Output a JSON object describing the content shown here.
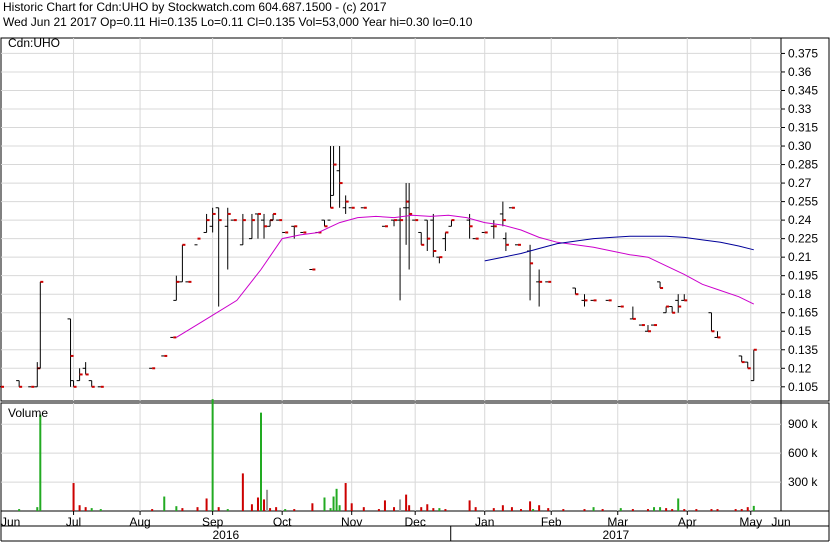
{
  "header": {
    "line1": "Historic Chart for Cdn:UHO by Stockwatch.com 604.687.1500 - (c) 2017",
    "line2": "Wed Jun 21 2017   Op=0.11   Hi=0.135   Lo=0.11   Cl=0.135   Vol=53,000   Year hi=0.30   lo=0.10"
  },
  "chart_data": {
    "type": "ohlc",
    "title": "Historic Chart for Cdn:UHO by Stockwatch.com 604.687.1500 - (c) 2017",
    "symbol_label": "Cdn:UHO",
    "summary": {
      "date": "Wed Jun 21 2017",
      "open": 0.11,
      "high": 0.135,
      "low": 0.11,
      "close": 0.135,
      "volume": 53000,
      "year_high": 0.3,
      "year_low": 0.1
    },
    "colors": {
      "ma_short": "#cc00cc",
      "ma_long": "#000099",
      "vol_up": "#22aa22",
      "vol_down": "#cc0000",
      "vol_flat": "#999999",
      "close_tick": "#cc0000",
      "grid": "#d8d8d8"
    },
    "price_axis": {
      "ylim": [
        0.0935,
        0.3875
      ],
      "ticks": [
        "0.375",
        "0.36",
        "0.345",
        "0.33",
        "0.315",
        "0.30",
        "0.285",
        "0.27",
        "0.255",
        "0.24",
        "0.225",
        "0.21",
        "0.195",
        "0.18",
        "0.165",
        "0.15",
        "0.135",
        "0.12",
        "0.105"
      ]
    },
    "volume_axis": {
      "label": "Volume",
      "ylim": [
        0,
        1120000
      ],
      "ticks": [
        "900 k",
        "600 k",
        "300 k"
      ]
    },
    "x_axis": {
      "months": [
        "Jun",
        "Jul",
        "Aug",
        "Sep",
        "Oct",
        "Nov",
        "Dec",
        "Jan",
        "Feb",
        "Mar",
        "Apr",
        "May",
        "Jun"
      ],
      "years": [
        "2016",
        "2017"
      ]
    },
    "x_range": [
      0,
      258
    ],
    "month_positions": [
      0,
      24,
      46,
      70,
      93,
      116,
      137,
      160,
      182,
      204,
      227,
      248,
      258
    ],
    "ohlc": [
      [
        0,
        0.105,
        0.105,
        0.105,
        0.105
      ],
      [
        6,
        0.11,
        0.11,
        0.105,
        0.105
      ],
      [
        10,
        0.105,
        0.105,
        0.105,
        0.105
      ],
      [
        12,
        0.105,
        0.125,
        0.105,
        0.12
      ],
      [
        13,
        0.12,
        0.19,
        0.12,
        0.19
      ],
      [
        23,
        0.16,
        0.16,
        0.105,
        0.13
      ],
      [
        24,
        0.11,
        0.11,
        0.105,
        0.105
      ],
      [
        26,
        0.11,
        0.12,
        0.11,
        0.115
      ],
      [
        28,
        0.12,
        0.125,
        0.115,
        0.115
      ],
      [
        30,
        0.11,
        0.11,
        0.105,
        0.105
      ],
      [
        33,
        0.105,
        0.105,
        0.105,
        0.105
      ],
      [
        50,
        0.12,
        0.12,
        0.12,
        0.12
      ],
      [
        54,
        0.13,
        0.13,
        0.13,
        0.13
      ],
      [
        57,
        0.145,
        0.145,
        0.145,
        0.145
      ],
      [
        58,
        0.175,
        0.195,
        0.175,
        0.19
      ],
      [
        60,
        0.19,
        0.22,
        0.19,
        0.22
      ],
      [
        62,
        0.19,
        0.19,
        0.19,
        0.19
      ],
      [
        65,
        0.22,
        0.22,
        0.22,
        0.225
      ],
      [
        68,
        0.23,
        0.245,
        0.23,
        0.24
      ],
      [
        70,
        0.235,
        0.25,
        0.23,
        0.245
      ],
      [
        72,
        0.25,
        0.25,
        0.17,
        0.24
      ],
      [
        75,
        0.235,
        0.25,
        0.2,
        0.245
      ],
      [
        77,
        0.24,
        0.24,
        0.24,
        0.24
      ],
      [
        80,
        0.22,
        0.245,
        0.22,
        0.24
      ],
      [
        83,
        0.225,
        0.245,
        0.225,
        0.24
      ],
      [
        85,
        0.245,
        0.245,
        0.225,
        0.245
      ],
      [
        87,
        0.24,
        0.245,
        0.225,
        0.235
      ],
      [
        89,
        0.235,
        0.24,
        0.235,
        0.24
      ],
      [
        90,
        0.24,
        0.245,
        0.24,
        0.245
      ],
      [
        92,
        0.24,
        0.24,
        0.24,
        0.24
      ],
      [
        94,
        0.23,
        0.23,
        0.23,
        0.23
      ],
      [
        97,
        0.235,
        0.235,
        0.225,
        0.235
      ],
      [
        100,
        0.23,
        0.23,
        0.23,
        0.23
      ],
      [
        103,
        0.2,
        0.2,
        0.2,
        0.2
      ],
      [
        105,
        0.23,
        0.23,
        0.23,
        0.23
      ],
      [
        107,
        0.24,
        0.24,
        0.235,
        0.235
      ],
      [
        109,
        0.24,
        0.3,
        0.25,
        0.25
      ],
      [
        110,
        0.26,
        0.3,
        0.26,
        0.285
      ],
      [
        112,
        0.28,
        0.3,
        0.25,
        0.27
      ],
      [
        114,
        0.25,
        0.26,
        0.245,
        0.255
      ],
      [
        116,
        0.25,
        0.25,
        0.25,
        0.25
      ],
      [
        120,
        0.25,
        0.25,
        0.25,
        0.25
      ],
      [
        127,
        0.235,
        0.235,
        0.235,
        0.235
      ],
      [
        130,
        0.24,
        0.24,
        0.235,
        0.24
      ],
      [
        132,
        0.24,
        0.25,
        0.175,
        0.24
      ],
      [
        134,
        0.25,
        0.27,
        0.22,
        0.255
      ],
      [
        135,
        0.25,
        0.27,
        0.2,
        0.245
      ],
      [
        137,
        0.24,
        0.24,
        0.24,
        0.24
      ],
      [
        139,
        0.23,
        0.23,
        0.22,
        0.22
      ],
      [
        141,
        0.24,
        0.24,
        0.215,
        0.225
      ],
      [
        143,
        0.24,
        0.245,
        0.21,
        0.215
      ],
      [
        145,
        0.21,
        0.21,
        0.205,
        0.21
      ],
      [
        147,
        0.225,
        0.23,
        0.215,
        0.23
      ],
      [
        149,
        0.235,
        0.24,
        0.235,
        0.24
      ],
      [
        155,
        0.24,
        0.245,
        0.225,
        0.235
      ],
      [
        157,
        0.225,
        0.225,
        0.225,
        0.225
      ],
      [
        160,
        0.23,
        0.23,
        0.23,
        0.23
      ],
      [
        163,
        0.235,
        0.24,
        0.225,
        0.235
      ],
      [
        166,
        0.245,
        0.255,
        0.235,
        0.24
      ],
      [
        167,
        0.225,
        0.23,
        0.215,
        0.22
      ],
      [
        169,
        0.25,
        0.25,
        0.25,
        0.25
      ],
      [
        171,
        0.22,
        0.22,
        0.22,
        0.22
      ],
      [
        175,
        0.215,
        0.22,
        0.175,
        0.205
      ],
      [
        178,
        0.19,
        0.2,
        0.17,
        0.19
      ],
      [
        181,
        0.19,
        0.19,
        0.19,
        0.19
      ],
      [
        190,
        0.185,
        0.185,
        0.18,
        0.18
      ],
      [
        193,
        0.175,
        0.18,
        0.17,
        0.175
      ],
      [
        196,
        0.175,
        0.175,
        0.175,
        0.175
      ],
      [
        201,
        0.175,
        0.175,
        0.175,
        0.175
      ],
      [
        205,
        0.17,
        0.17,
        0.17,
        0.17
      ],
      [
        209,
        0.16,
        0.17,
        0.16,
        0.16
      ],
      [
        212,
        0.155,
        0.155,
        0.155,
        0.155
      ],
      [
        214,
        0.15,
        0.155,
        0.15,
        0.15
      ],
      [
        216,
        0.155,
        0.155,
        0.155,
        0.155
      ],
      [
        218,
        0.19,
        0.19,
        0.185,
        0.185
      ],
      [
        220,
        0.165,
        0.17,
        0.165,
        0.17
      ],
      [
        222,
        0.17,
        0.17,
        0.165,
        0.165
      ],
      [
        224,
        0.175,
        0.18,
        0.165,
        0.17
      ],
      [
        226,
        0.175,
        0.18,
        0.175,
        0.175
      ],
      [
        235,
        0.165,
        0.165,
        0.15,
        0.15
      ],
      [
        237,
        0.145,
        0.15,
        0.145,
        0.145
      ],
      [
        245,
        0.13,
        0.13,
        0.125,
        0.125
      ],
      [
        247,
        0.125,
        0.125,
        0.12,
        0.12
      ],
      [
        249,
        0.11,
        0.135,
        0.11,
        0.135
      ]
    ],
    "ma_short": [
      [
        58,
        0.145
      ],
      [
        68,
        0.16
      ],
      [
        78,
        0.175
      ],
      [
        86,
        0.2
      ],
      [
        93,
        0.225
      ],
      [
        99,
        0.228
      ],
      [
        105,
        0.23
      ],
      [
        112,
        0.238
      ],
      [
        118,
        0.242
      ],
      [
        124,
        0.243
      ],
      [
        130,
        0.242
      ],
      [
        136,
        0.244
      ],
      [
        142,
        0.243
      ],
      [
        148,
        0.244
      ],
      [
        154,
        0.242
      ],
      [
        160,
        0.238
      ],
      [
        166,
        0.236
      ],
      [
        172,
        0.232
      ],
      [
        178,
        0.226
      ],
      [
        184,
        0.222
      ],
      [
        190,
        0.22
      ],
      [
        196,
        0.218
      ],
      [
        202,
        0.215
      ],
      [
        208,
        0.212
      ],
      [
        214,
        0.21
      ],
      [
        220,
        0.203
      ],
      [
        226,
        0.196
      ],
      [
        232,
        0.188
      ],
      [
        238,
        0.183
      ],
      [
        244,
        0.178
      ],
      [
        249,
        0.172
      ]
    ],
    "ma_long": [
      [
        160,
        0.207
      ],
      [
        166,
        0.21
      ],
      [
        172,
        0.213
      ],
      [
        178,
        0.217
      ],
      [
        184,
        0.221
      ],
      [
        190,
        0.223
      ],
      [
        196,
        0.225
      ],
      [
        202,
        0.226
      ],
      [
        208,
        0.227
      ],
      [
        214,
        0.227
      ],
      [
        220,
        0.227
      ],
      [
        226,
        0.226
      ],
      [
        232,
        0.224
      ],
      [
        238,
        0.222
      ],
      [
        244,
        0.219
      ],
      [
        249,
        0.216
      ]
    ],
    "volume": [
      [
        6,
        20000,
        "g"
      ],
      [
        12,
        40000,
        "g"
      ],
      [
        13,
        1000000,
        "g"
      ],
      [
        24,
        290000,
        "r"
      ],
      [
        26,
        60000,
        "r"
      ],
      [
        28,
        40000,
        "r"
      ],
      [
        30,
        30000,
        "g"
      ],
      [
        33,
        20000,
        "g"
      ],
      [
        50,
        20000,
        "r"
      ],
      [
        54,
        150000,
        "g"
      ],
      [
        58,
        50000,
        "g"
      ],
      [
        60,
        30000,
        "r"
      ],
      [
        65,
        40000,
        "r"
      ],
      [
        68,
        130000,
        "r"
      ],
      [
        70,
        1160000,
        "g"
      ],
      [
        72,
        40000,
        "r"
      ],
      [
        75,
        20000,
        "g"
      ],
      [
        80,
        390000,
        "r"
      ],
      [
        83,
        70000,
        "r"
      ],
      [
        85,
        140000,
        "r"
      ],
      [
        86,
        1020000,
        "g"
      ],
      [
        87,
        120000,
        "r"
      ],
      [
        88,
        220000,
        "f"
      ],
      [
        89,
        30000,
        "r"
      ],
      [
        91,
        40000,
        "r"
      ],
      [
        94,
        20000,
        "g"
      ],
      [
        97,
        20000,
        "r"
      ],
      [
        103,
        80000,
        "r"
      ],
      [
        107,
        140000,
        "g"
      ],
      [
        109,
        30000,
        "g"
      ],
      [
        110,
        150000,
        "g"
      ],
      [
        111,
        230000,
        "g"
      ],
      [
        112,
        60000,
        "g"
      ],
      [
        114,
        290000,
        "r"
      ],
      [
        116,
        80000,
        "r"
      ],
      [
        120,
        40000,
        "r"
      ],
      [
        125,
        20000,
        "r"
      ],
      [
        127,
        110000,
        "r"
      ],
      [
        130,
        40000,
        "r"
      ],
      [
        132,
        120000,
        "f"
      ],
      [
        134,
        170000,
        "r"
      ],
      [
        135,
        60000,
        "r"
      ],
      [
        139,
        40000,
        "r"
      ],
      [
        141,
        70000,
        "r"
      ],
      [
        143,
        30000,
        "r"
      ],
      [
        145,
        30000,
        "g"
      ],
      [
        147,
        20000,
        "r"
      ],
      [
        155,
        110000,
        "r"
      ],
      [
        157,
        40000,
        "r"
      ],
      [
        163,
        30000,
        "r"
      ],
      [
        166,
        60000,
        "r"
      ],
      [
        169,
        40000,
        "r"
      ],
      [
        172,
        20000,
        "r"
      ],
      [
        175,
        100000,
        "r"
      ],
      [
        176,
        20000,
        "g"
      ],
      [
        178,
        60000,
        "r"
      ],
      [
        181,
        30000,
        "r"
      ],
      [
        186,
        20000,
        "r"
      ],
      [
        193,
        20000,
        "r"
      ],
      [
        196,
        40000,
        "g"
      ],
      [
        199,
        20000,
        "r"
      ],
      [
        205,
        30000,
        "g"
      ],
      [
        209,
        20000,
        "r"
      ],
      [
        214,
        20000,
        "r"
      ],
      [
        216,
        40000,
        "g"
      ],
      [
        218,
        40000,
        "g"
      ],
      [
        220,
        30000,
        "r"
      ],
      [
        222,
        20000,
        "r"
      ],
      [
        224,
        130000,
        "g"
      ],
      [
        226,
        20000,
        "r"
      ],
      [
        230,
        20000,
        "r"
      ],
      [
        235,
        20000,
        "r"
      ],
      [
        237,
        20000,
        "r"
      ],
      [
        243,
        20000,
        "r"
      ],
      [
        245,
        20000,
        "r"
      ],
      [
        247,
        40000,
        "r"
      ],
      [
        249,
        53000,
        "g"
      ]
    ]
  }
}
